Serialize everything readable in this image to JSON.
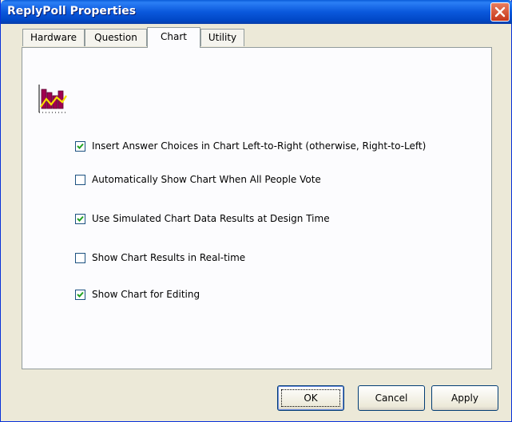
{
  "window": {
    "title": "ReplyPoll Properties"
  },
  "tabs": [
    {
      "label": "Hardware",
      "active": false
    },
    {
      "label": "Question",
      "active": false
    },
    {
      "label": "Chart",
      "active": true
    },
    {
      "label": "Utility",
      "active": false
    }
  ],
  "options": [
    {
      "label": "Insert Answer Choices in Chart Left-to-Right (otherwise, Right-to-Left)",
      "checked": true
    },
    {
      "label": "Automatically Show Chart When All People Vote",
      "checked": false
    },
    {
      "label": "Use Simulated Chart Data Results at Design Time",
      "checked": true
    },
    {
      "label": "Show Chart Results in Real-time",
      "checked": false
    },
    {
      "label": "Show Chart for Editing",
      "checked": true
    }
  ],
  "buttons": {
    "ok": "OK",
    "cancel": "Cancel",
    "apply": "Apply"
  },
  "icons": {
    "close": "close-icon",
    "chart": "bar-line-chart-icon",
    "check": "checkmark-icon"
  },
  "colors": {
    "titlebar": "#0a58dc",
    "close_button": "#d9502f",
    "dialog_face": "#ece9d8",
    "chart_bars": "#a0004f",
    "chart_line": "#f5e000"
  }
}
